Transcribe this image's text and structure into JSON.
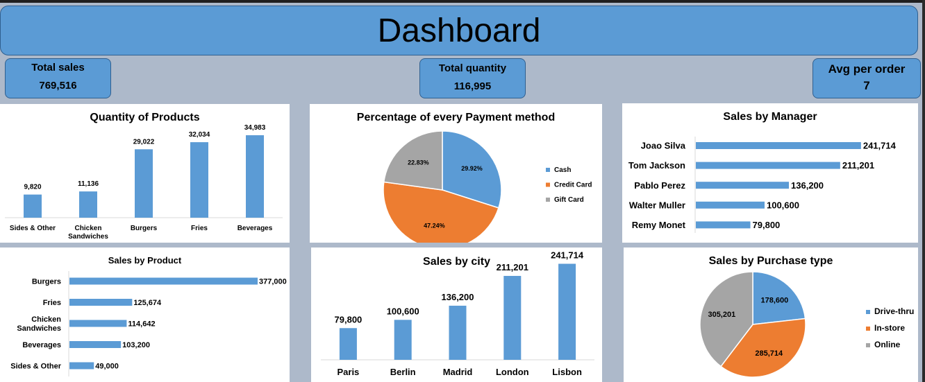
{
  "dashboard": {
    "title": "Dashboard",
    "kpis": [
      {
        "label": "Total sales",
        "value": "769,516"
      },
      {
        "label": "Total quantity",
        "value": "116,995"
      },
      {
        "label": "Avg per order",
        "value": "7"
      }
    ]
  },
  "colors": {
    "bar": "#5b9bd5",
    "cash": "#5b9bd5",
    "credit": "#ed7d31",
    "gift": "#a5a5a5",
    "banner": "#5b9bd5",
    "background": "#adb9ca"
  },
  "chart_data": [
    {
      "id": "quantity",
      "type": "bar",
      "title": "Quantity of Products",
      "categories": [
        "Sides & Other",
        "Chicken Sandwiches",
        "Burgers",
        "Fries",
        "Beverages"
      ],
      "category_lines": [
        [
          "Sides & Other"
        ],
        [
          "Chicken",
          "Sandwiches"
        ],
        [
          "Burgers"
        ],
        [
          "Fries"
        ],
        [
          "Beverages"
        ]
      ],
      "values": [
        9820,
        11136,
        29022,
        32034,
        34983
      ],
      "value_labels": [
        "9,820",
        "11,136",
        "29,022",
        "32,034",
        "34,983"
      ],
      "ylim": [
        0,
        40000
      ]
    },
    {
      "id": "payment",
      "type": "pie",
      "title": "Percentage of every Payment method",
      "labels": [
        "Cash",
        "Credit Card",
        "Gift Card"
      ],
      "values": [
        29.92,
        47.24,
        22.83
      ],
      "value_labels": [
        "29.92%",
        "47.24%",
        "22.83%"
      ],
      "legend": "right"
    },
    {
      "id": "manager",
      "type": "bar",
      "orientation": "horizontal",
      "title": "Sales by Manager",
      "categories": [
        "Joao Silva",
        "Tom Jackson",
        "Pablo Perez",
        "Walter Muller",
        "Remy Monet"
      ],
      "values": [
        241714,
        211201,
        136200,
        100600,
        79800
      ],
      "value_labels": [
        "241,714",
        "211,201",
        "136,200",
        "100,600",
        "79,800"
      ],
      "xlim": [
        0,
        250000
      ]
    },
    {
      "id": "product",
      "type": "bar",
      "orientation": "horizontal",
      "title": "Sales by Product",
      "categories": [
        "Burgers",
        "Fries",
        "Chicken Sandwiches",
        "Beverages",
        "Sides & Other"
      ],
      "category_lines": [
        [
          "Burgers"
        ],
        [
          "Fries"
        ],
        [
          "Chicken",
          "Sandwiches"
        ],
        [
          "Beverages"
        ],
        [
          "Sides & Other"
        ]
      ],
      "values": [
        377000,
        125674,
        114642,
        103200,
        49000
      ],
      "value_labels": [
        "377,000",
        "125,674",
        "114,642",
        "103,200",
        "49,000"
      ],
      "xlim": [
        0,
        377000
      ]
    },
    {
      "id": "city",
      "type": "bar",
      "title": "Sales by city",
      "categories": [
        "Paris",
        "Berlin",
        "Madrid",
        "London",
        "Lisbon"
      ],
      "values": [
        79800,
        100600,
        136200,
        211201,
        241714
      ],
      "value_labels": [
        "79,800",
        "100,600",
        "136,200",
        "211,201",
        "241,714"
      ],
      "ylim": [
        0,
        260000
      ]
    },
    {
      "id": "purchase",
      "type": "pie",
      "title": "Sales by Purchase type",
      "labels": [
        "Drive-thru",
        "In-store",
        "Online"
      ],
      "values": [
        178600,
        285714,
        305201
      ],
      "value_labels": [
        "178,600",
        "285,714",
        "305,201"
      ],
      "legend": "right"
    }
  ]
}
